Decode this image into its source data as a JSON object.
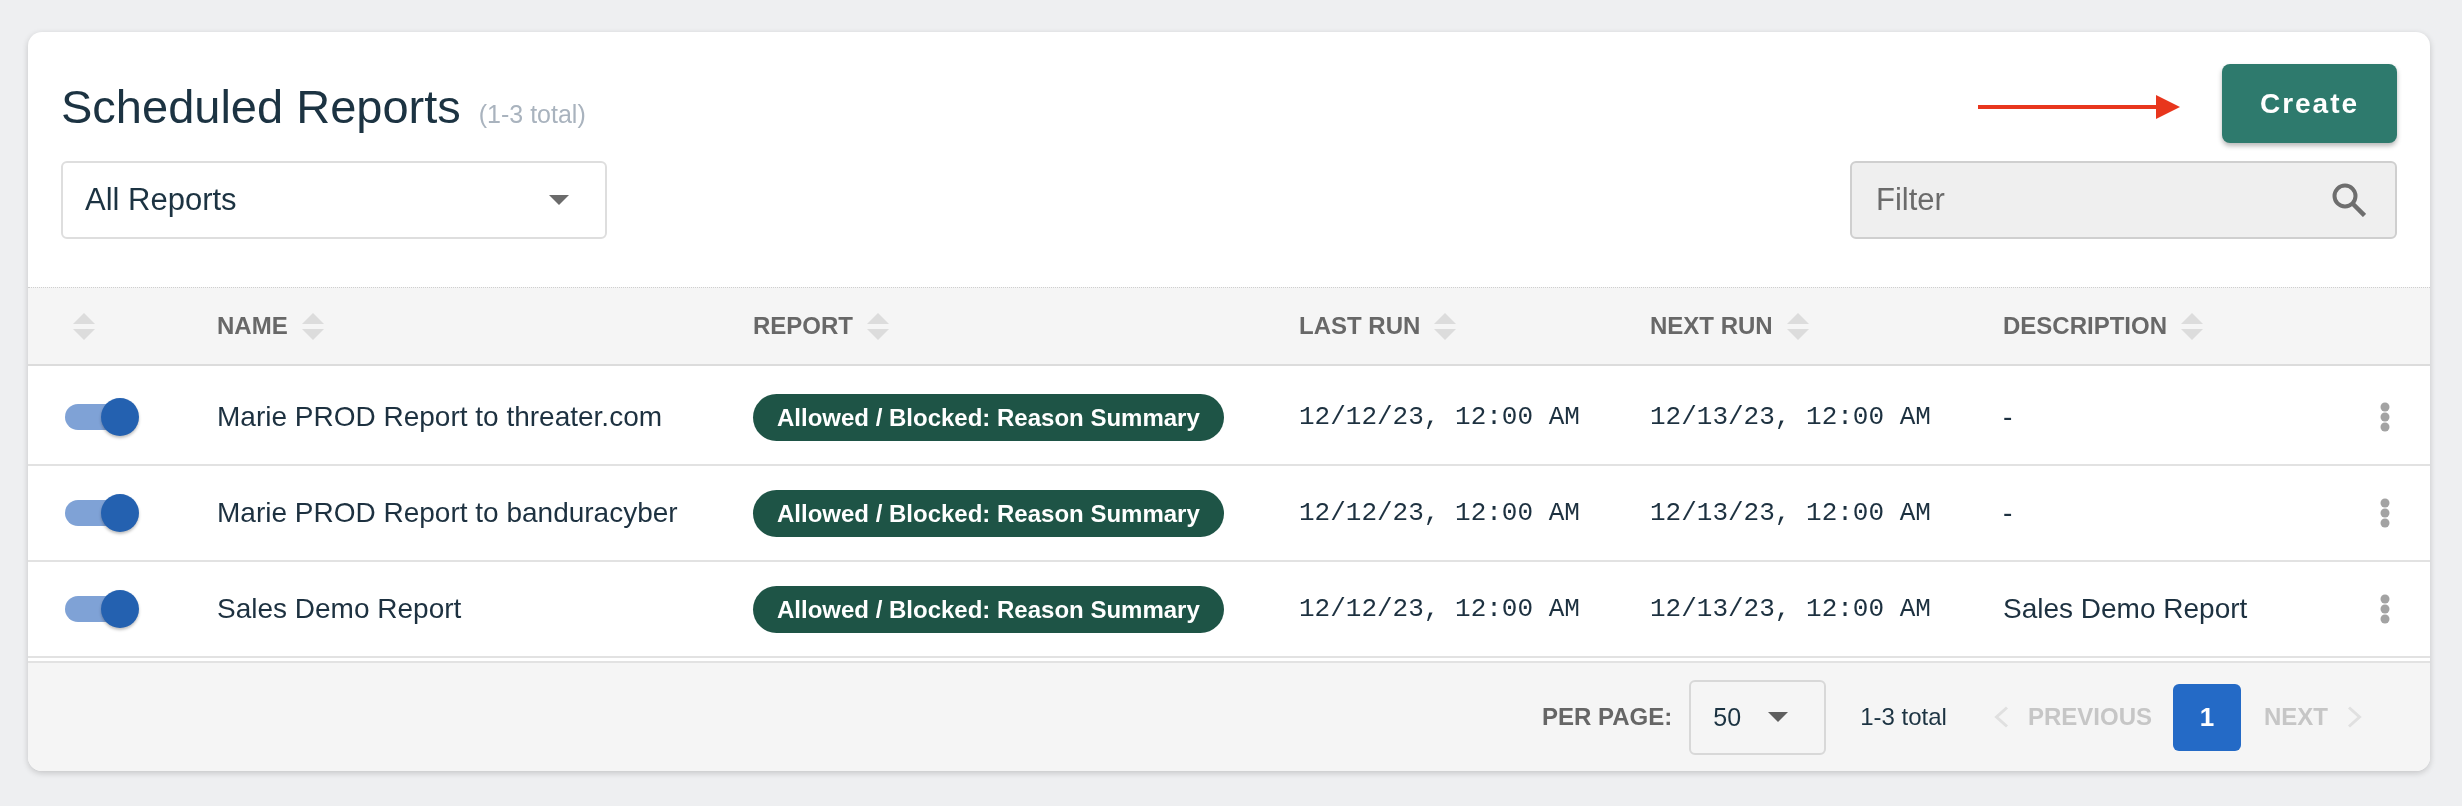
{
  "header": {
    "title": "Scheduled Reports",
    "count": "(1-3 total)",
    "create_button": "Create"
  },
  "filters": {
    "report_select": "All Reports",
    "search": {
      "placeholder": "Filter"
    }
  },
  "table": {
    "columns": [
      {
        "label": "NAME"
      },
      {
        "label": "REPORT"
      },
      {
        "label": "LAST RUN"
      },
      {
        "label": "NEXT RUN"
      },
      {
        "label": "DESCRIPTION"
      }
    ],
    "rows": [
      {
        "enabled": true,
        "name": "Marie PROD Report to threater.com",
        "report": "Allowed / Blocked: Reason Summary",
        "last_run": "12/12/23, 12:00 AM",
        "next_run": "12/13/23, 12:00 AM",
        "description": "-"
      },
      {
        "enabled": true,
        "name": "Marie PROD Report to banduracyber",
        "report": "Allowed / Blocked: Reason Summary",
        "last_run": "12/12/23, 12:00 AM",
        "next_run": "12/13/23, 12:00 AM",
        "description": "-"
      },
      {
        "enabled": true,
        "name": "Sales Demo Report",
        "report": "Allowed / Blocked: Reason Summary",
        "last_run": "12/12/23, 12:00 AM",
        "next_run": "12/13/23, 12:00 AM",
        "description": "Sales Demo Report"
      }
    ]
  },
  "pagination": {
    "per_page_label": "PER PAGE:",
    "per_page": "50",
    "summary": "1-3 total",
    "previous": {
      "label": "PREVIOUS",
      "disabled": true
    },
    "pages": [
      {
        "label": "1",
        "selected": true
      }
    ],
    "next": {
      "label": "NEXT",
      "disabled": true
    }
  }
}
